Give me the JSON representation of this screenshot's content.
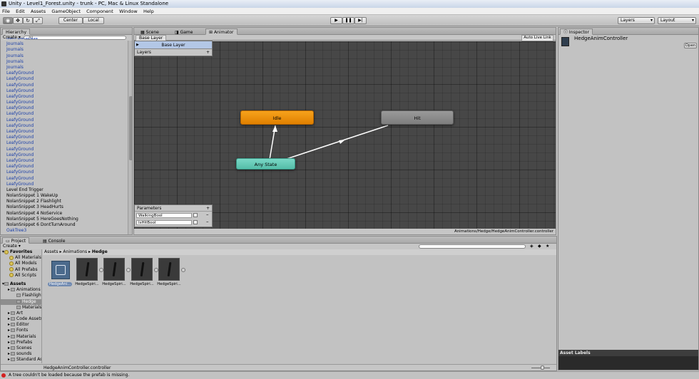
{
  "window": {
    "title": "Unity - Level1_Forest.unity - trunk - PC, Mac & Linux Standalone"
  },
  "menu": [
    "File",
    "Edit",
    "Assets",
    "GameObject",
    "Component",
    "Window",
    "Help"
  ],
  "toolbar": {
    "center_label": "Center",
    "local_label": "Local",
    "layers_label": "Layers",
    "layout_label": "Layout"
  },
  "hierarchy": {
    "tab": "Hierarchy",
    "create_label": "Create",
    "search_placeholder": "All",
    "items": [
      {
        "label": "Item Database",
        "blue": true
      },
      {
        "label": "Journals",
        "blue": true
      },
      {
        "label": "Journals",
        "blue": true
      },
      {
        "label": "Journals",
        "blue": true
      },
      {
        "label": "Journals",
        "blue": true
      },
      {
        "label": "Journals",
        "blue": true
      },
      {
        "label": "LeafyGround",
        "blue": true
      },
      {
        "label": "LeafyGround",
        "blue": true
      },
      {
        "label": "LeafyGround",
        "blue": true
      },
      {
        "label": "LeafyGround",
        "blue": true
      },
      {
        "label": "LeafyGround",
        "blue": true
      },
      {
        "label": "LeafyGround",
        "blue": true
      },
      {
        "label": "LeafyGround",
        "blue": true
      },
      {
        "label": "LeafyGround",
        "blue": true
      },
      {
        "label": "LeafyGround",
        "blue": true
      },
      {
        "label": "LeafyGround",
        "blue": true
      },
      {
        "label": "LeafyGround",
        "blue": true
      },
      {
        "label": "LeafyGround",
        "blue": true
      },
      {
        "label": "LeafyGround",
        "blue": true
      },
      {
        "label": "LeafyGround",
        "blue": true
      },
      {
        "label": "LeafyGround",
        "blue": true
      },
      {
        "label": "LeafyGround",
        "blue": true
      },
      {
        "label": "LeafyGround",
        "blue": true
      },
      {
        "label": "LeafyGround",
        "blue": true
      },
      {
        "label": "LeafyGround",
        "blue": true
      },
      {
        "label": "LeafyGround",
        "blue": true
      },
      {
        "label": "Level End Trigger",
        "blue": false
      },
      {
        "label": "NolanSnippet 1 WakeUp",
        "blue": false
      },
      {
        "label": "NolanSnippet 2 Flashlight",
        "blue": false
      },
      {
        "label": "NolanSnippet 3 HeadHurts",
        "blue": false
      },
      {
        "label": "NolanSnippet 4 NoService",
        "blue": false
      },
      {
        "label": "NolanSnippet 5 HereGoesNothing",
        "blue": false
      },
      {
        "label": "NolanSnippet 6 DontTurnAround",
        "blue": false
      },
      {
        "label": "OakTree3",
        "blue": true
      }
    ]
  },
  "center_tabs": [
    {
      "label": "Scene",
      "active": false
    },
    {
      "label": "Game",
      "active": false
    },
    {
      "label": "Animator",
      "active": true
    }
  ],
  "animator": {
    "breadcrumb": "Base Layer",
    "auto_live_link": "Auto Live Link",
    "layers_title": "Layers",
    "layer_name": "Base Layer",
    "parameters_title": "Parameters",
    "parameters": [
      {
        "name": "WalkingBool"
      },
      {
        "name": "IsHitBool"
      }
    ],
    "states": {
      "idle": "Idle",
      "hit": "Hit",
      "any": "Any State"
    },
    "path": "Animations/Hedge/HedgeAnimController.controller",
    "colors": {
      "idle": "#f08c00",
      "hit": "#8a8a8a",
      "any": "#5fc9b5",
      "grid": "#474747"
    }
  },
  "inspector": {
    "tab": "Inspector",
    "object_name": "HedgeAnimController",
    "open_label": "Open",
    "asset_labels": "Asset Labels"
  },
  "project": {
    "tabs": [
      {
        "label": "Project",
        "active": true
      },
      {
        "label": "Console",
        "active": false
      }
    ],
    "create_label": "Create",
    "breadcrumb": [
      "Assets",
      "Animations",
      "Hedge"
    ],
    "favorites_label": "Favorites",
    "favorites": [
      "All Materials",
      "All Models",
      "All Prefabs",
      "All Scripts"
    ],
    "assets_label": "Assets",
    "tree": [
      {
        "label": "Animations",
        "indent": 1
      },
      {
        "label": "Flashlight",
        "indent": 2
      },
      {
        "label": "Hedge",
        "indent": 2,
        "selected": true
      },
      {
        "label": "Materials",
        "indent": 2
      },
      {
        "label": "Art",
        "indent": 1
      },
      {
        "label": "Code Assets",
        "indent": 1
      },
      {
        "label": "Editor",
        "indent": 1
      },
      {
        "label": "Fonts",
        "indent": 1
      },
      {
        "label": "Materials",
        "indent": 1
      },
      {
        "label": "Prefabs",
        "indent": 1
      },
      {
        "label": "Scenes",
        "indent": 1
      },
      {
        "label": "sounds",
        "indent": 1
      },
      {
        "label": "Standard As",
        "indent": 1
      }
    ],
    "assets": [
      {
        "label": "HedgeAni..."
      },
      {
        "label": "HedgeSpiri..."
      },
      {
        "label": "HedgeSpiri..."
      },
      {
        "label": "HedgeSpiri..."
      },
      {
        "label": "HedgeSpiri..."
      }
    ],
    "selected_file": "HedgeAnimController.controller"
  },
  "status": {
    "message": "A tree couldn't be loaded because the prefab is missing.",
    "error_color": "#d42020"
  }
}
